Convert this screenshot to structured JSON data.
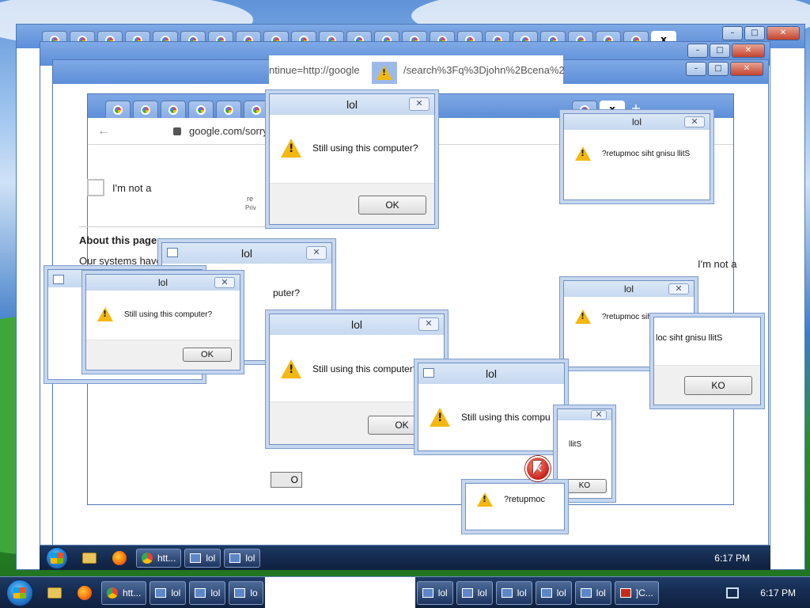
{
  "dialog": {
    "title": "lol",
    "message": "Still using this computer?",
    "message_mirrored": "?retupmoc siht gnisu llitS",
    "ok_label": "OK",
    "ok_mirrored": "KO",
    "close_glyph": "✕",
    "message_partial_1": "puter?",
    "message_partial_2": "Still using this compu",
    "message_partial_3": "?retupmoc",
    "message_partial_4": "llitS",
    "message_partial_5": "loc siht gnisu llitS",
    "ok_partial": "O"
  },
  "browser": {
    "address_partial_top": "ntinue=http://google",
    "address_partial_top_2": "/search%3Fq%3Djohn%2Bcena%2",
    "address_main": "google.com/sorry/inc",
    "active_tab_label": "x",
    "new_tab_label": "+",
    "caption_min": "–",
    "caption_max": "□",
    "caption_close": "✕"
  },
  "page": {
    "recaptcha_label": "I'm not a",
    "recaptcha_label_right": "I'm not a",
    "about_heading": "About this page",
    "about_text": "Our systems have d",
    "re_fragment": "re",
    "priv_fragment": "Priv"
  },
  "taskbar": {
    "items_bottom": [
      {
        "icon": "chrome",
        "label": "htt..."
      },
      {
        "icon": "window",
        "label": "lol"
      },
      {
        "icon": "window",
        "label": "lol"
      },
      {
        "icon": "window",
        "label": "lo"
      },
      {
        "icon": "window",
        "label": "lol"
      },
      {
        "icon": "window",
        "label": "lol"
      },
      {
        "icon": "window",
        "label": "lol"
      },
      {
        "icon": "window",
        "label": "lol"
      },
      {
        "icon": "window",
        "label": "lol"
      },
      {
        "icon": "error",
        "label": "]C..."
      }
    ],
    "items_mid": [
      {
        "icon": "chrome",
        "label": "htt..."
      },
      {
        "icon": "window",
        "label": "lol"
      },
      {
        "icon": "window",
        "label": "lol"
      }
    ],
    "clock": "6:17 PM",
    "clock_ghost": "6:17 PM"
  },
  "colors": {
    "accent": "#2b87d8",
    "warning": "#f3b80f",
    "error": "#c8201a"
  }
}
